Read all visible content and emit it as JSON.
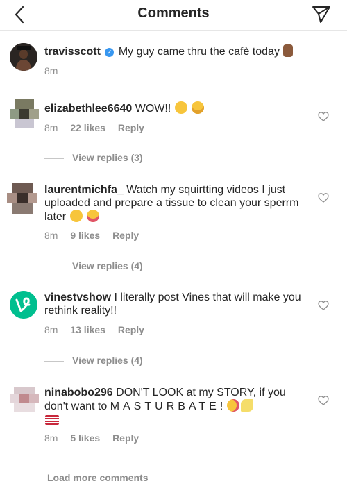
{
  "header": {
    "title": "Comments"
  },
  "caption": {
    "username": "travisscott",
    "text": "My guy came thru the cafè today",
    "time": "8m"
  },
  "comments": [
    {
      "username": "elizabethlee6640",
      "text": "WOW!!",
      "time": "8m",
      "likes": "22 likes",
      "reply": "Reply",
      "view_replies": "View replies (3)"
    },
    {
      "username": "laurentmichfa_",
      "text": "Watch my squirtting videos I just uploaded and prepare a tissue to clean your sperrm later",
      "time": "8m",
      "likes": "9 likes",
      "reply": "Reply",
      "view_replies": "View replies (4)"
    },
    {
      "username": "vinestvshow",
      "text": "I literally post Vines that will make you rethink reality!!",
      "time": "8m",
      "likes": "13 likes",
      "reply": "Reply",
      "view_replies": "View replies (4)"
    },
    {
      "username": "ninabobo296",
      "text_part1": "DON'T LOOK at my STORY, if you don't want to",
      "text_spaced": "MASTURBATE!",
      "time": "8m",
      "likes": "5 likes",
      "reply": "Reply"
    }
  ],
  "load_more": "Load more comments",
  "icons": {
    "back": "chevron-left-icon",
    "send": "paper-plane-icon",
    "like": "heart-outline-icon",
    "verified": "verified-badge-icon",
    "vine_logo": "vine-logo-icon"
  },
  "colors": {
    "muted": "#8e8e8e",
    "verified": "#3897f0",
    "vine": "#00bf8f"
  }
}
